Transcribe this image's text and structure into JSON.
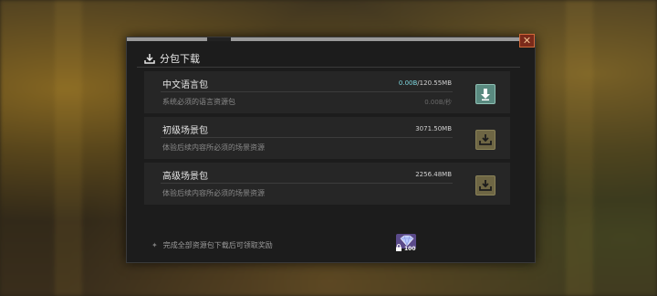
{
  "dialog": {
    "title": "分包下载",
    "close_label": "✕"
  },
  "packages": [
    {
      "name": "中文语言包",
      "desc": "系统必须的语言资源包",
      "size_current": "0.00B",
      "size_total": "/120.55MB",
      "speed": "0.00B/秒",
      "state": "downloading"
    },
    {
      "name": "初级场景包",
      "desc": "体验后续内容所必须的场景资源",
      "size_total": "3071.50MB",
      "state": "idle"
    },
    {
      "name": "高级场景包",
      "desc": "体验后续内容所必须的场景资源",
      "size_total": "2256.48MB",
      "state": "idle"
    }
  ],
  "footer": {
    "bullet": "✦",
    "note": "完成全部资源包下载后可领取奖励",
    "reward_count": "100"
  },
  "colors": {
    "accent_cyan": "#7fd8e0",
    "download_active": "#5a8a80",
    "download_idle": "#6e6644",
    "close_red": "#7a2a1a"
  },
  "icons": {
    "header": "download-icon",
    "active_button": "arrow-down-icon",
    "idle_button": "download-tray-icon",
    "reward": "diamond-icon",
    "lock": "lock-icon"
  }
}
